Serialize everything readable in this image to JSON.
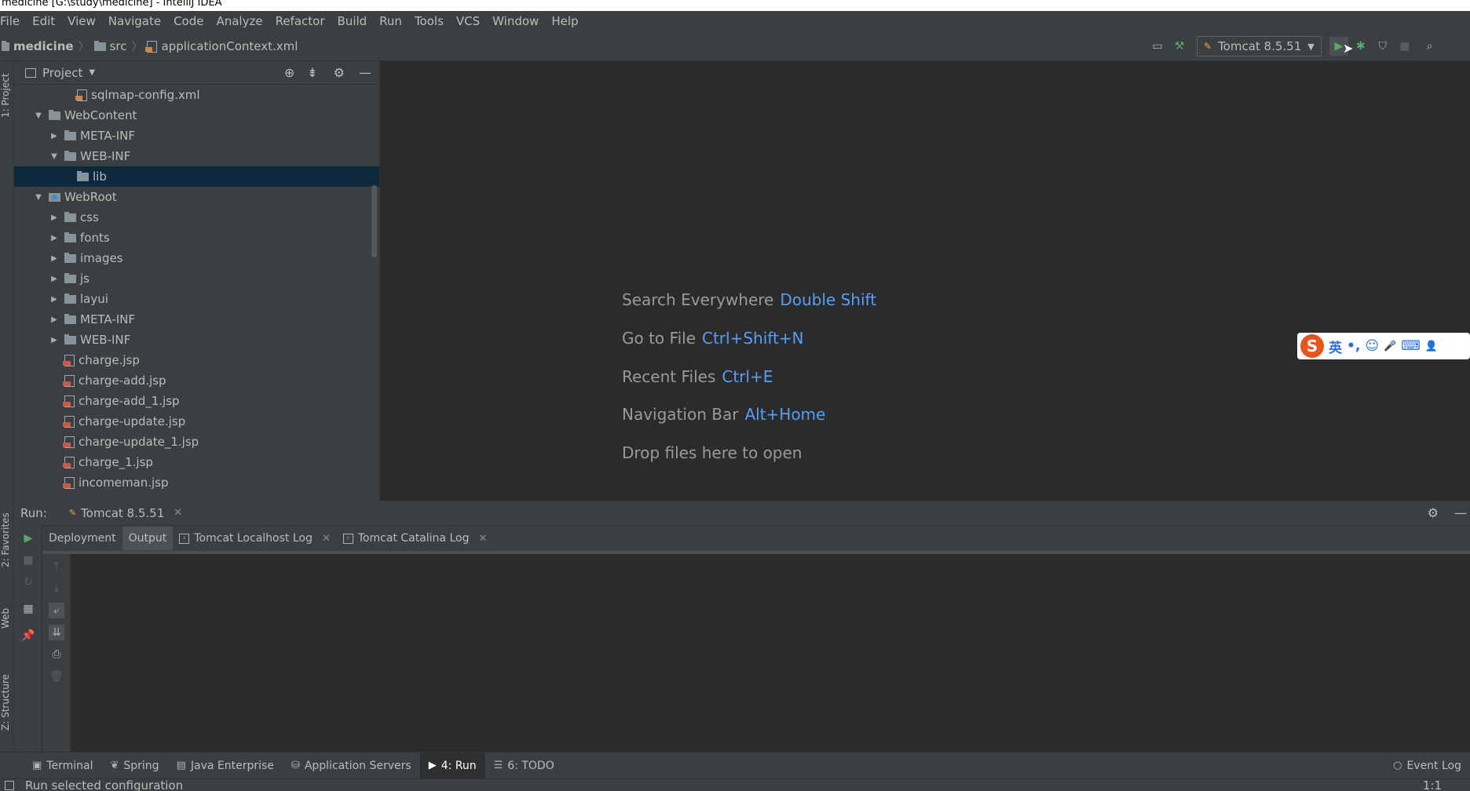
{
  "window": {
    "title": "medicine [G:\\study\\medicine] - IntelliJ IDEA"
  },
  "menu": [
    "File",
    "Edit",
    "View",
    "Navigate",
    "Code",
    "Analyze",
    "Refactor",
    "Build",
    "Run",
    "Tools",
    "VCS",
    "Window",
    "Help"
  ],
  "breadcrumb": [
    "medicine",
    "src",
    "applicationContext.xml"
  ],
  "toolbar": {
    "run_config": "Tomcat 8.5.51"
  },
  "project": {
    "header": "Project",
    "tree": [
      {
        "label": "sqlmap-config.xml",
        "type": "xml",
        "level": 2,
        "arrow": ""
      },
      {
        "label": "WebContent",
        "type": "folder",
        "level": 0,
        "arrow": "down"
      },
      {
        "label": "META-INF",
        "type": "folder",
        "level": 1,
        "arrow": "right"
      },
      {
        "label": "WEB-INF",
        "type": "folder",
        "level": 1,
        "arrow": "down"
      },
      {
        "label": "lib",
        "type": "folder",
        "level": 2,
        "arrow": "",
        "selected": true
      },
      {
        "label": "WebRoot",
        "type": "web",
        "level": 0,
        "arrow": "down"
      },
      {
        "label": "css",
        "type": "folder",
        "level": 1,
        "arrow": "right"
      },
      {
        "label": "fonts",
        "type": "folder",
        "level": 1,
        "arrow": "right"
      },
      {
        "label": "images",
        "type": "folder",
        "level": 1,
        "arrow": "right"
      },
      {
        "label": "js",
        "type": "folder",
        "level": 1,
        "arrow": "right"
      },
      {
        "label": "layui",
        "type": "folder",
        "level": 1,
        "arrow": "right"
      },
      {
        "label": "META-INF",
        "type": "folder",
        "level": 1,
        "arrow": "right"
      },
      {
        "label": "WEB-INF",
        "type": "folder",
        "level": 1,
        "arrow": "right"
      },
      {
        "label": "charge.jsp",
        "type": "jsp",
        "level": 1,
        "arrow": ""
      },
      {
        "label": "charge-add.jsp",
        "type": "jsp",
        "level": 1,
        "arrow": ""
      },
      {
        "label": "charge-add_1.jsp",
        "type": "jsp",
        "level": 1,
        "arrow": ""
      },
      {
        "label": "charge-update.jsp",
        "type": "jsp",
        "level": 1,
        "arrow": ""
      },
      {
        "label": "charge-update_1.jsp",
        "type": "jsp",
        "level": 1,
        "arrow": ""
      },
      {
        "label": "charge_1.jsp",
        "type": "jsp",
        "level": 1,
        "arrow": ""
      },
      {
        "label": "incomeman.jsp",
        "type": "jsp",
        "level": 1,
        "arrow": ""
      }
    ]
  },
  "editor_hints": [
    {
      "text": "Search Everywhere",
      "key": "Double Shift"
    },
    {
      "text": "Go to File",
      "key": "Ctrl+Shift+N"
    },
    {
      "text": "Recent Files",
      "key": "Ctrl+E"
    },
    {
      "text": "Navigation Bar",
      "key": "Alt+Home"
    },
    {
      "text": "Drop files here to open",
      "key": ""
    }
  ],
  "ime": {
    "logo": "S",
    "mode": "英",
    "punct": "•,",
    "icons": [
      "☺",
      "🎤",
      "⌨",
      "👤"
    ]
  },
  "run": {
    "label": "Run:",
    "tab": "Tomcat 8.5.51",
    "subtabs": [
      "Deployment",
      "Output",
      "Tomcat Localhost Log",
      "Tomcat Catalina Log"
    ]
  },
  "side_tabs": {
    "project": "1: Project",
    "favorites": "2: Favorites",
    "web": "Web",
    "structure": "Z: Structure"
  },
  "bottom_tabs": [
    {
      "icon": "terminal-icon",
      "label": "Terminal"
    },
    {
      "icon": "spring-icon",
      "label": "Spring"
    },
    {
      "icon": "java-enterprise-icon",
      "label": "Java Enterprise"
    },
    {
      "icon": "app-servers-icon",
      "label": "Application Servers"
    },
    {
      "icon": "run-icon",
      "label": "4: Run",
      "active": true
    },
    {
      "icon": "todo-icon",
      "label": "6: TODO"
    }
  ],
  "event_log": "Event Log",
  "status": {
    "message": "Run selected configuration",
    "position": "1:1"
  },
  "colors": {
    "accent_key": "#589df6",
    "selection": "#0d293e",
    "run_green": "#59a869"
  }
}
